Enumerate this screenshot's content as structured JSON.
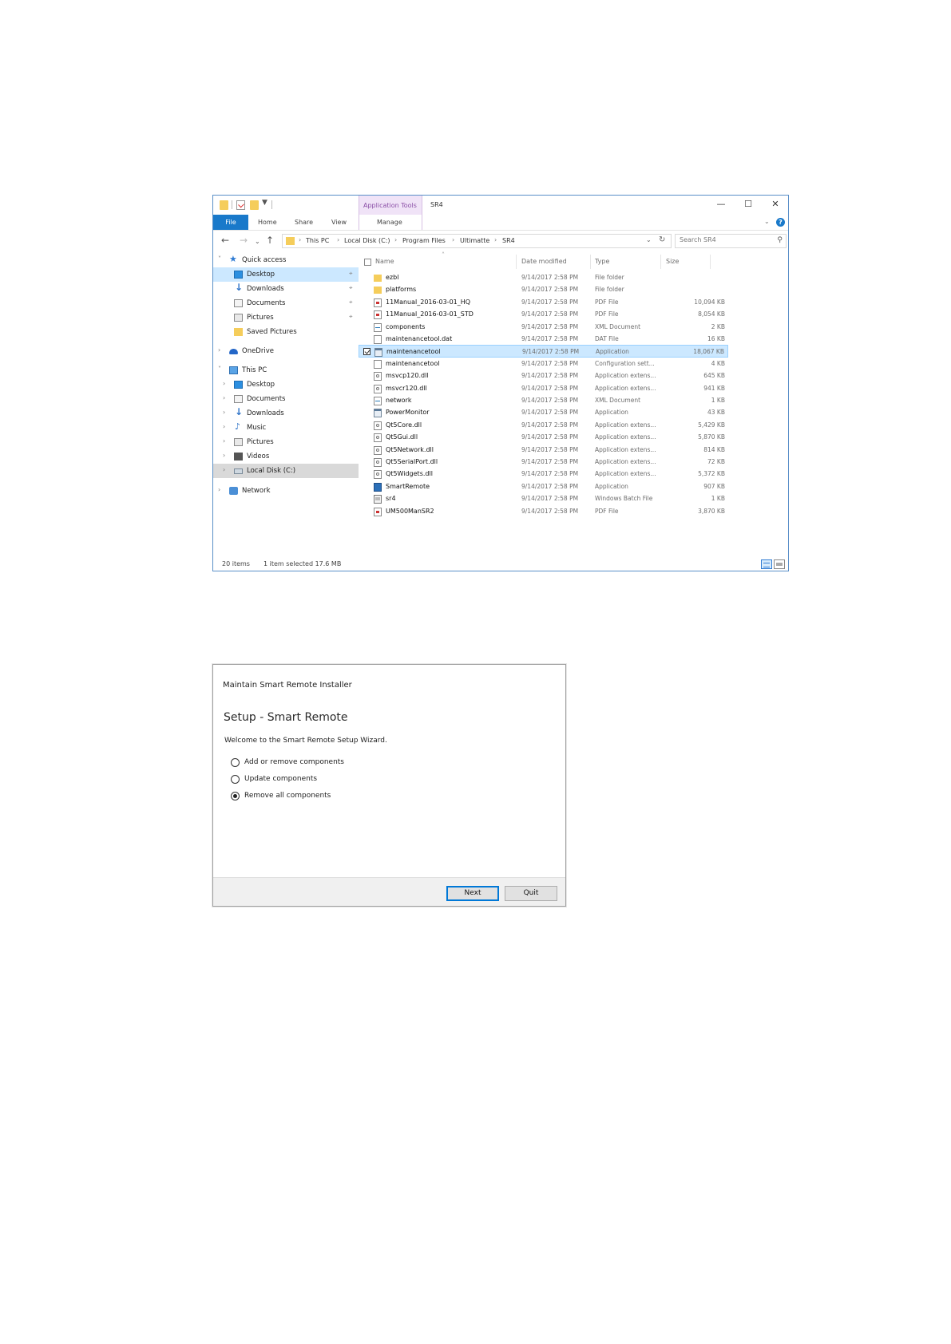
{
  "explorer": {
    "title": "SR4",
    "quick_access_toolbar": [
      "folder-icon",
      "properties-icon",
      "new-folder-icon",
      "customize-icon"
    ],
    "contextual_tab_group": "Application Tools",
    "ribbon": {
      "tabs": [
        "File",
        "Home",
        "Share",
        "View",
        "Manage"
      ],
      "active_tab": "File"
    },
    "window_controls": [
      "minimize",
      "maximize",
      "close"
    ],
    "address": {
      "crumbs": [
        "This PC",
        "Local Disk (C:)",
        "Program Files",
        "Ultimatte",
        "SR4"
      ]
    },
    "search": {
      "placeholder": "Search SR4"
    },
    "sidebar": {
      "items": [
        {
          "label": "Quick access",
          "icon": "star-icon",
          "expander": "open",
          "indent": 0
        },
        {
          "label": "Desktop",
          "icon": "desktop-icon",
          "pinned": true,
          "indent": 1,
          "selected": true
        },
        {
          "label": "Downloads",
          "icon": "download-icon",
          "pinned": true,
          "indent": 1
        },
        {
          "label": "Documents",
          "icon": "documents-icon",
          "pinned": true,
          "indent": 1
        },
        {
          "label": "Pictures",
          "icon": "pictures-icon",
          "pinned": true,
          "indent": 1
        },
        {
          "label": "Saved Pictures",
          "icon": "folder-icon",
          "indent": 1
        },
        {
          "label": "OneDrive",
          "icon": "onedrive-icon",
          "expander": "closed",
          "indent": 0
        },
        {
          "label": "This PC",
          "icon": "pc-icon",
          "expander": "open",
          "indent": 0
        },
        {
          "label": "Desktop",
          "icon": "desktop-icon",
          "expander": "closed",
          "indent": 1
        },
        {
          "label": "Documents",
          "icon": "documents-icon",
          "expander": "closed",
          "indent": 1
        },
        {
          "label": "Downloads",
          "icon": "download-icon",
          "expander": "closed",
          "indent": 1
        },
        {
          "label": "Music",
          "icon": "music-icon",
          "expander": "closed",
          "indent": 1
        },
        {
          "label": "Pictures",
          "icon": "pictures-icon",
          "expander": "closed",
          "indent": 1
        },
        {
          "label": "Videos",
          "icon": "videos-icon",
          "expander": "closed",
          "indent": 1
        },
        {
          "label": "Local Disk (C:)",
          "icon": "disk-icon",
          "expander": "closed",
          "indent": 1,
          "dim": true
        },
        {
          "label": "Network",
          "icon": "network-icon",
          "expander": "closed",
          "indent": 0
        }
      ]
    },
    "columns": [
      "Name",
      "Date modified",
      "Type",
      "Size"
    ],
    "files": [
      {
        "name": "ezbl",
        "date": "9/14/2017 2:58 PM",
        "type": "File folder",
        "size": "",
        "icon": "folder-icon"
      },
      {
        "name": "platforms",
        "date": "9/14/2017 2:58 PM",
        "type": "File folder",
        "size": "",
        "icon": "folder-icon"
      },
      {
        "name": "11Manual_2016-03-01_HQ",
        "date": "9/14/2017 2:58 PM",
        "type": "PDF File",
        "size": "10,094 KB",
        "icon": "pdf-icon"
      },
      {
        "name": "11Manual_2016-03-01_STD",
        "date": "9/14/2017 2:58 PM",
        "type": "PDF File",
        "size": "8,054 KB",
        "icon": "pdf-icon"
      },
      {
        "name": "components",
        "date": "9/14/2017 2:58 PM",
        "type": "XML Document",
        "size": "2 KB",
        "icon": "xml-icon"
      },
      {
        "name": "maintenancetool.dat",
        "date": "9/14/2017 2:58 PM",
        "type": "DAT File",
        "size": "16 KB",
        "icon": "file-icon"
      },
      {
        "name": "maintenancetool",
        "date": "9/14/2017 2:58 PM",
        "type": "Application",
        "size": "18,067 KB",
        "icon": "app-icon",
        "selected": true
      },
      {
        "name": "maintenancetool",
        "date": "9/14/2017 2:58 PM",
        "type": "Configuration sett...",
        "size": "4 KB",
        "icon": "file-icon"
      },
      {
        "name": "msvcp120.dll",
        "date": "9/14/2017 2:58 PM",
        "type": "Application extens...",
        "size": "645 KB",
        "icon": "dll-icon"
      },
      {
        "name": "msvcr120.dll",
        "date": "9/14/2017 2:58 PM",
        "type": "Application extens...",
        "size": "941 KB",
        "icon": "dll-icon"
      },
      {
        "name": "network",
        "date": "9/14/2017 2:58 PM",
        "type": "XML Document",
        "size": "1 KB",
        "icon": "xml-icon"
      },
      {
        "name": "PowerMonitor",
        "date": "9/14/2017 2:58 PM",
        "type": "Application",
        "size": "43 KB",
        "icon": "app-icon"
      },
      {
        "name": "Qt5Core.dll",
        "date": "9/14/2017 2:58 PM",
        "type": "Application extens...",
        "size": "5,429 KB",
        "icon": "dll-icon"
      },
      {
        "name": "Qt5Gui.dll",
        "date": "9/14/2017 2:58 PM",
        "type": "Application extens...",
        "size": "5,870 KB",
        "icon": "dll-icon"
      },
      {
        "name": "Qt5Network.dll",
        "date": "9/14/2017 2:58 PM",
        "type": "Application extens...",
        "size": "814 KB",
        "icon": "dll-icon"
      },
      {
        "name": "Qt5SerialPort.dll",
        "date": "9/14/2017 2:58 PM",
        "type": "Application extens...",
        "size": "72 KB",
        "icon": "dll-icon"
      },
      {
        "name": "Qt5Widgets.dll",
        "date": "9/14/2017 2:58 PM",
        "type": "Application extens...",
        "size": "5,372 KB",
        "icon": "dll-icon"
      },
      {
        "name": "SmartRemote",
        "date": "9/14/2017 2:58 PM",
        "type": "Application",
        "size": "907 KB",
        "icon": "app-blue-icon"
      },
      {
        "name": "sr4",
        "date": "9/14/2017 2:58 PM",
        "type": "Windows Batch File",
        "size": "1 KB",
        "icon": "batch-icon"
      },
      {
        "name": "UM500ManSR2",
        "date": "9/14/2017 2:58 PM",
        "type": "PDF File",
        "size": "3,870 KB",
        "icon": "pdf-icon"
      }
    ],
    "status": {
      "item_count": "20 items",
      "selection": "1 item selected  17.6 MB"
    },
    "colors": {
      "accent": "#1979ca",
      "selection": "#cce8ff",
      "context_tab": "#f0e3f7"
    }
  },
  "installer": {
    "title": "Maintain Smart Remote Installer",
    "heading": "Setup - Smart Remote",
    "welcome": "Welcome to the Smart Remote Setup Wizard.",
    "options": [
      {
        "label": "Add or remove components",
        "checked": false
      },
      {
        "label": "Update components",
        "checked": false
      },
      {
        "label": "Remove all components",
        "checked": true
      }
    ],
    "buttons": {
      "next": "Next",
      "quit": "Quit"
    },
    "colors": {
      "default_button_border": "#0078d7"
    }
  }
}
